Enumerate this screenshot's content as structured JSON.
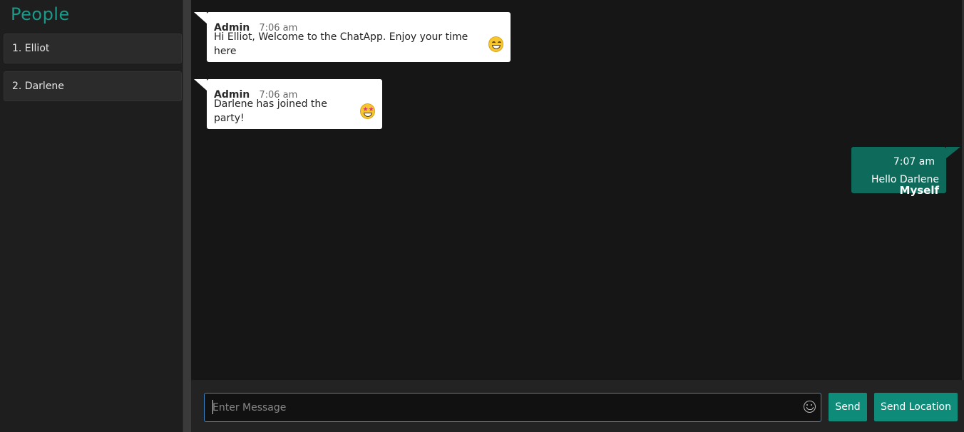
{
  "sidebar": {
    "title": "People",
    "people": [
      "1. Elliot",
      "2. Darlene"
    ]
  },
  "messages": [
    {
      "sender": "Admin",
      "time": "7:06 am",
      "text": "Hi Elliot, Welcome to the ChatApp. Enjoy your time here",
      "emoji": "grinning-face-icon"
    },
    {
      "sender": "Admin",
      "time": "7:06 am",
      "text": "Darlene has joined the party!",
      "emoji": "star-struck-icon"
    }
  ],
  "my_message": {
    "time": "7:07 am",
    "sender": "Myself",
    "text": "Hello Darlene"
  },
  "composer": {
    "placeholder": "Enter Message",
    "send_label": "Send",
    "send_location_label": "Send Location"
  },
  "colors": {
    "accent": "#0e8c79",
    "title": "#1a9a8a",
    "outgoing_bubble": "#0e6b5c",
    "incoming_bubble": "#ffffff",
    "input_border": "#3a86c8"
  }
}
